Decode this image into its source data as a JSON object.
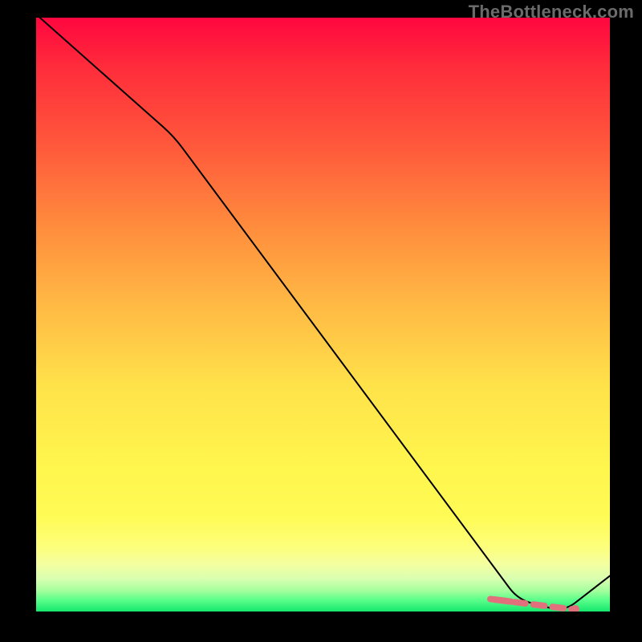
{
  "watermark": "TheBottleneck.com",
  "colors": {
    "accent_pink": "#e2707c",
    "curve": "#000000",
    "bg_top": "#ff063f",
    "bg_bottom": "#16e76e"
  },
  "chart_data": {
    "type": "line",
    "title": "",
    "xlabel": "",
    "ylabel": "",
    "xlim": [
      0,
      100
    ],
    "ylim": [
      0,
      100
    ],
    "grid": false,
    "series": [
      {
        "name": "bottleneck-curve",
        "x": [
          -4,
          24,
          84,
          92,
          100
        ],
        "y": [
          104,
          80,
          2,
          0,
          6
        ],
        "style": "solid",
        "color": "#000000"
      },
      {
        "name": "highlight-dashed",
        "x": [
          80,
          94
        ],
        "y": [
          2,
          0.3
        ],
        "style": "dashed",
        "color": "#e2707c"
      }
    ],
    "points": [
      {
        "name": "highlight-end-dot",
        "x": 94,
        "y": 0.4,
        "color": "#e2707c",
        "r": 5
      }
    ],
    "annotations": []
  }
}
